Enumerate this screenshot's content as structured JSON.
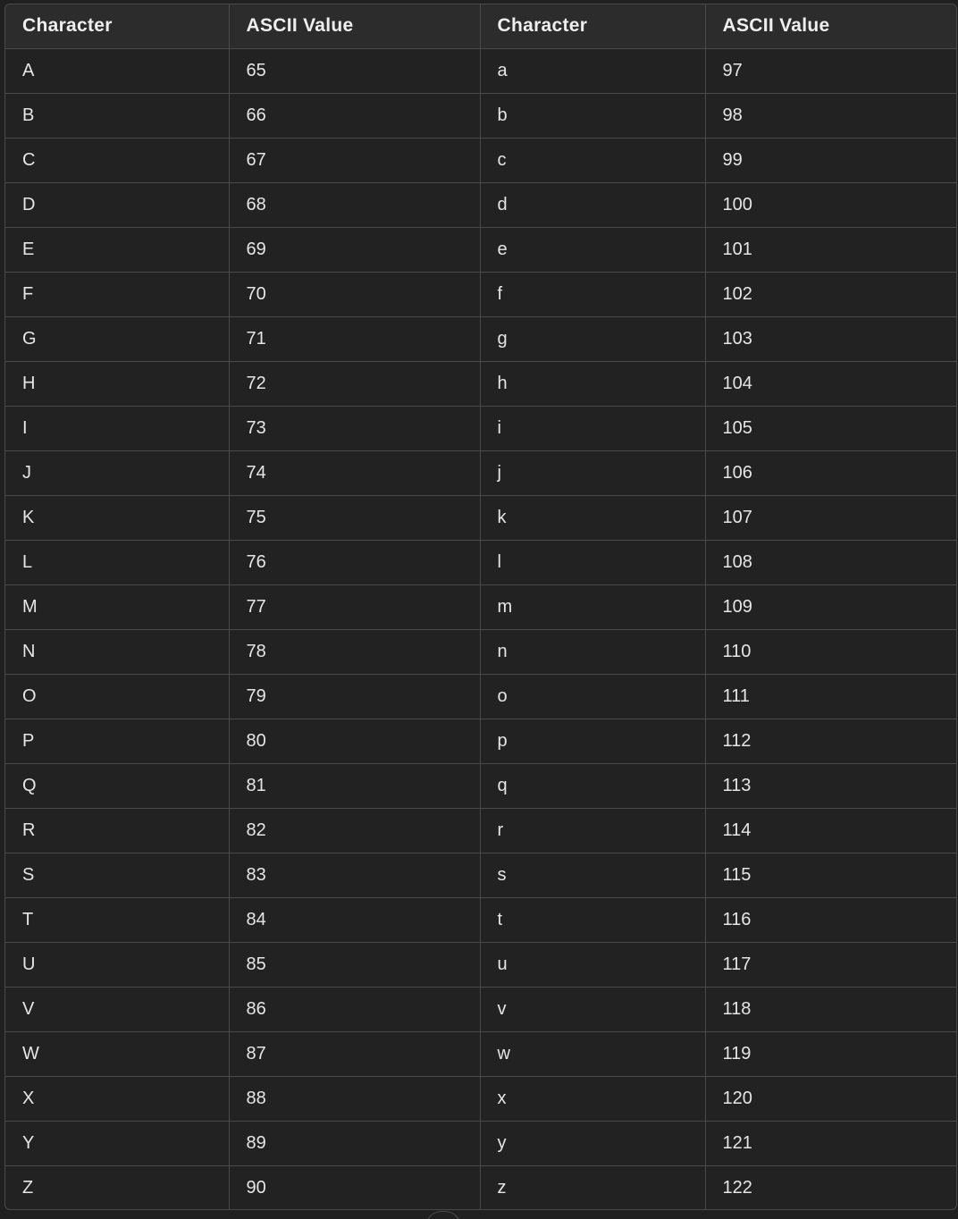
{
  "table": {
    "headers": [
      "Character",
      "ASCII Value",
      "Character",
      "ASCII Value"
    ],
    "rows": [
      [
        "A",
        "65",
        "a",
        "97"
      ],
      [
        "B",
        "66",
        "b",
        "98"
      ],
      [
        "C",
        "67",
        "c",
        "99"
      ],
      [
        "D",
        "68",
        "d",
        "100"
      ],
      [
        "E",
        "69",
        "e",
        "101"
      ],
      [
        "F",
        "70",
        "f",
        "102"
      ],
      [
        "G",
        "71",
        "g",
        "103"
      ],
      [
        "H",
        "72",
        "h",
        "104"
      ],
      [
        "I",
        "73",
        "i",
        "105"
      ],
      [
        "J",
        "74",
        "j",
        "106"
      ],
      [
        "K",
        "75",
        "k",
        "107"
      ],
      [
        "L",
        "76",
        "l",
        "108"
      ],
      [
        "M",
        "77",
        "m",
        "109"
      ],
      [
        "N",
        "78",
        "n",
        "110"
      ],
      [
        "O",
        "79",
        "o",
        "111"
      ],
      [
        "P",
        "80",
        "p",
        "112"
      ],
      [
        "Q",
        "81",
        "q",
        "113"
      ],
      [
        "R",
        "82",
        "r",
        "114"
      ],
      [
        "S",
        "83",
        "s",
        "115"
      ],
      [
        "T",
        "84",
        "t",
        "116"
      ],
      [
        "U",
        "85",
        "u",
        "117"
      ],
      [
        "V",
        "86",
        "v",
        "118"
      ],
      [
        "W",
        "87",
        "w",
        "119"
      ],
      [
        "X",
        "88",
        "x",
        "120"
      ],
      [
        "Y",
        "89",
        "y",
        "121"
      ],
      [
        "Z",
        "90",
        "z",
        "122"
      ]
    ]
  },
  "colors": {
    "background": "#202020",
    "header_background": "#2c2c2c",
    "border": "#4a4a4a",
    "text": "#e6e6e6"
  }
}
